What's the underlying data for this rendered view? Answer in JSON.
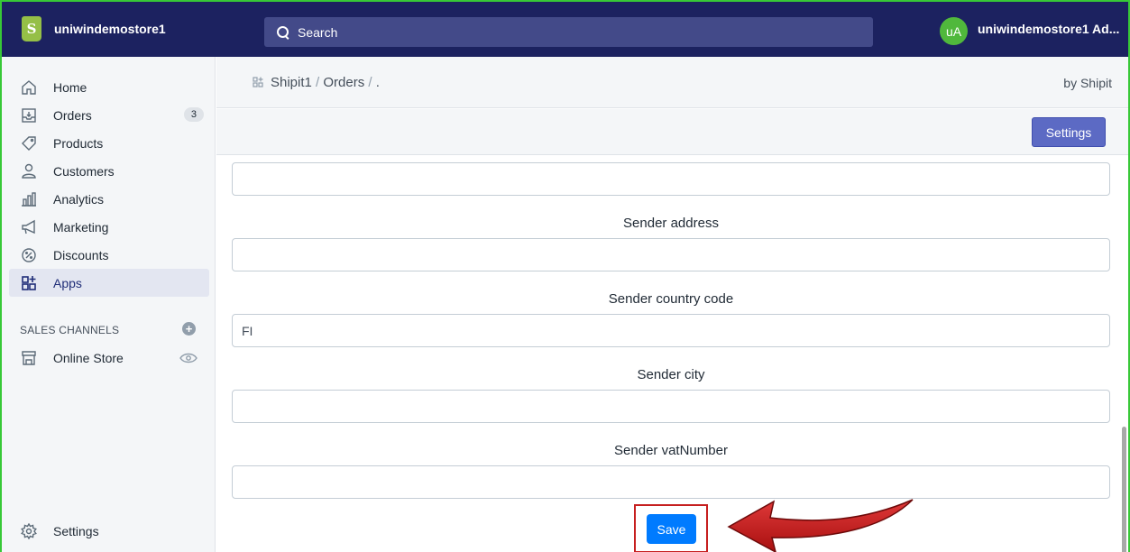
{
  "topbar": {
    "logo_letter": "S",
    "store_name": "uniwindemostore1",
    "search_placeholder": "Search",
    "avatar_initials": "uA",
    "account_name": "uniwindemostore1 Ad..."
  },
  "sidebar": {
    "items": [
      {
        "label": "Home",
        "icon": "home-icon"
      },
      {
        "label": "Orders",
        "icon": "orders-icon",
        "badge": "3"
      },
      {
        "label": "Products",
        "icon": "tag-icon"
      },
      {
        "label": "Customers",
        "icon": "person-icon"
      },
      {
        "label": "Analytics",
        "icon": "bar-chart-icon"
      },
      {
        "label": "Marketing",
        "icon": "megaphone-icon"
      },
      {
        "label": "Discounts",
        "icon": "discount-icon"
      },
      {
        "label": "Apps",
        "icon": "apps-icon",
        "active": true
      }
    ],
    "sales_channels_title": "SALES CHANNELS",
    "online_store_label": "Online Store",
    "settings_label": "Settings"
  },
  "main": {
    "breadcrumb": {
      "app": "Shipit1",
      "sep1": "/",
      "section": "Orders",
      "sep2": "/",
      "current": "."
    },
    "by_label": "by Shipit",
    "settings_button": "Settings",
    "form": {
      "fields": [
        {
          "label": "",
          "value": ""
        },
        {
          "label": "Sender address",
          "value": ""
        },
        {
          "label": "Sender country code",
          "value": "FI"
        },
        {
          "label": "Sender city",
          "value": ""
        },
        {
          "label": "Sender vatNumber",
          "value": ""
        }
      ],
      "save_button": "Save"
    }
  },
  "colors": {
    "topbar_bg": "#1c2260",
    "search_bg": "#434a89",
    "avatar_bg": "#50b83c",
    "settings_btn": "#5c6ac4",
    "save_btn": "#007bff",
    "highlight": "#c61f1f",
    "frame_border": "#37c837"
  }
}
